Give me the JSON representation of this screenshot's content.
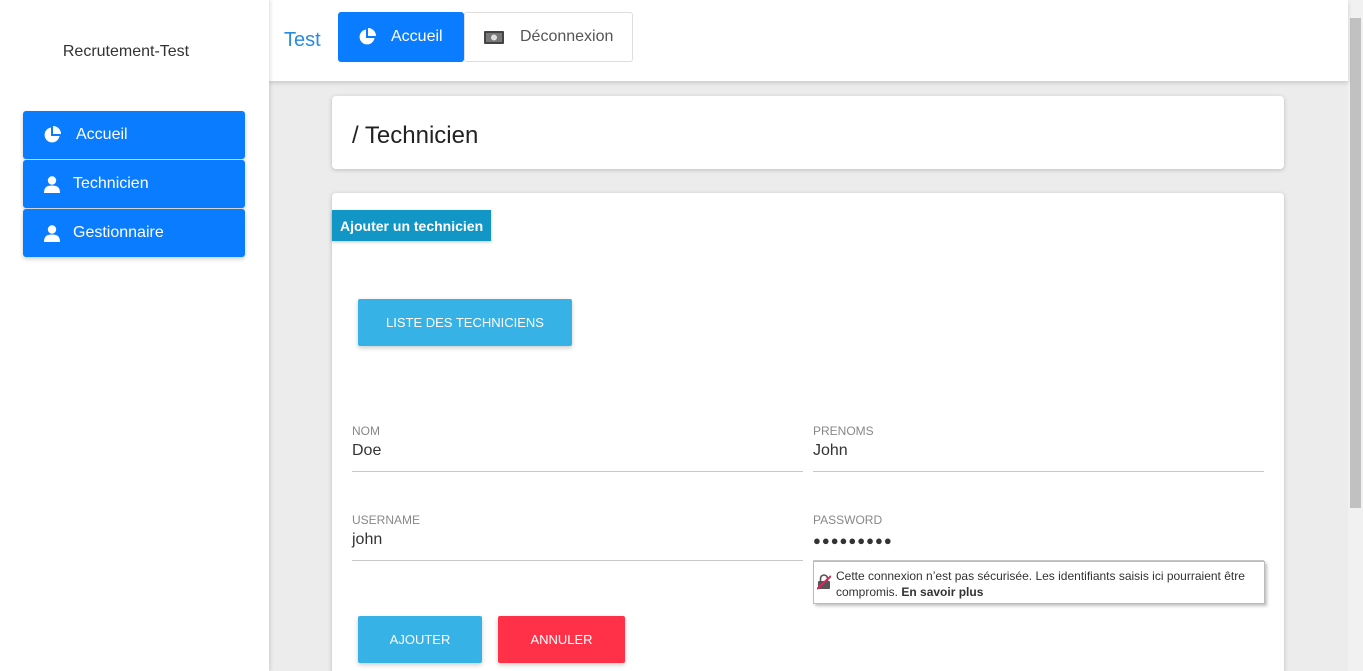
{
  "sidebar": {
    "brand": "Recrutement-Test",
    "items": [
      {
        "label": "Accueil",
        "icon": "pie-chart-icon"
      },
      {
        "label": "Technicien",
        "icon": "user-icon"
      },
      {
        "label": "Gestionnaire",
        "icon": "user-icon"
      }
    ]
  },
  "topbar": {
    "title": "Test",
    "tabs": [
      {
        "label": "Accueil",
        "icon": "pie-chart-icon"
      },
      {
        "label": "Déconnexion",
        "icon": "money-icon"
      }
    ]
  },
  "breadcrumb": "/ Technicien",
  "form": {
    "badge": "Ajouter un technicien",
    "list_button": "LISTE DES TECHNICIENS",
    "fields": {
      "nom": {
        "label": "NOM",
        "value": "Doe"
      },
      "prenoms": {
        "label": "PRENOMS",
        "value": "John"
      },
      "username": {
        "label": "USERNAME",
        "value": "john"
      },
      "password": {
        "label": "PASSWORD",
        "value": "●●●●●●●●●"
      }
    },
    "add_button": "AJOUTER",
    "cancel_button": "ANNULER"
  },
  "security_warning": {
    "text": "Cette connexion n’est pas sécurisée. Les identifiants saisis ici pourraient être compromis.",
    "link": "En savoir plus"
  },
  "colors": {
    "primary": "#0a7cff",
    "info": "#36b2e6",
    "danger": "#ff3149",
    "badge": "#1296c5"
  }
}
